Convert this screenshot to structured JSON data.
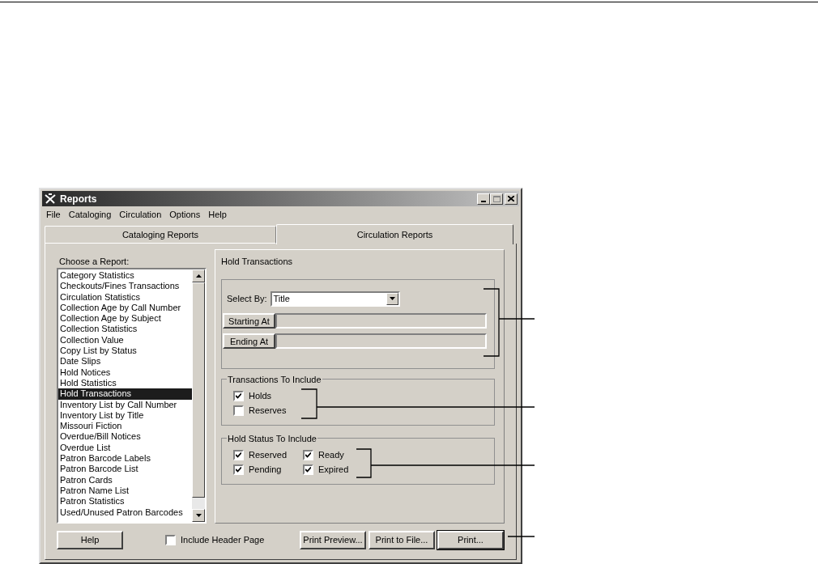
{
  "window": {
    "title": "Reports"
  },
  "menu": [
    "File",
    "Cataloging",
    "Circulation",
    "Options",
    "Help"
  ],
  "tabs": [
    {
      "label": "Cataloging Reports",
      "selected": false
    },
    {
      "label": "Circulation Reports",
      "selected": true
    }
  ],
  "report_list": {
    "label": "Choose a Report:",
    "items": [
      {
        "label": "Category Statistics",
        "selected": false
      },
      {
        "label": "Checkouts/Fines Transactions",
        "selected": false
      },
      {
        "label": "Circulation Statistics",
        "selected": false
      },
      {
        "label": "Collection Age by Call Number",
        "selected": false
      },
      {
        "label": "Collection Age by Subject",
        "selected": false
      },
      {
        "label": "Collection Statistics",
        "selected": false
      },
      {
        "label": "Collection Value",
        "selected": false
      },
      {
        "label": "Copy List by Status",
        "selected": false
      },
      {
        "label": "Date Slips",
        "selected": false
      },
      {
        "label": "Hold Notices",
        "selected": false
      },
      {
        "label": "Hold Statistics",
        "selected": false
      },
      {
        "label": "Hold Transactions",
        "selected": true
      },
      {
        "label": "Inventory List by Call Number",
        "selected": false
      },
      {
        "label": "Inventory List by Title",
        "selected": false
      },
      {
        "label": "Missouri Fiction",
        "selected": false
      },
      {
        "label": "Overdue/Bill Notices",
        "selected": false
      },
      {
        "label": "Overdue List",
        "selected": false
      },
      {
        "label": "Patron Barcode Labels",
        "selected": false
      },
      {
        "label": "Patron Barcode List",
        "selected": false
      },
      {
        "label": "Patron Cards",
        "selected": false
      },
      {
        "label": "Patron Name List",
        "selected": false
      },
      {
        "label": "Patron Statistics",
        "selected": false
      },
      {
        "label": "Used/Unused Patron Barcodes",
        "selected": false
      }
    ]
  },
  "report_panel": {
    "title": "Hold Transactions",
    "select_by": {
      "label": "Select By:",
      "value": "Title"
    },
    "range_buttons": [
      "Starting At",
      "Ending At"
    ],
    "transactions_group": {
      "title": "Transactions To Include",
      "options": [
        {
          "label": "Holds",
          "checked": true
        },
        {
          "label": "Reserves",
          "checked": false
        }
      ]
    },
    "status_group": {
      "title": "Hold Status To Include",
      "options": [
        {
          "label": "Reserved",
          "checked": true
        },
        {
          "label": "Ready",
          "checked": true
        },
        {
          "label": "Pending",
          "checked": true
        },
        {
          "label": "Expired",
          "checked": true
        }
      ]
    }
  },
  "footer": {
    "help_button": "Help",
    "include_header_page": {
      "label": "Include Header Page",
      "checked": false
    },
    "buttons": [
      "Print Preview...",
      "Print to File...",
      "Print..."
    ]
  }
}
